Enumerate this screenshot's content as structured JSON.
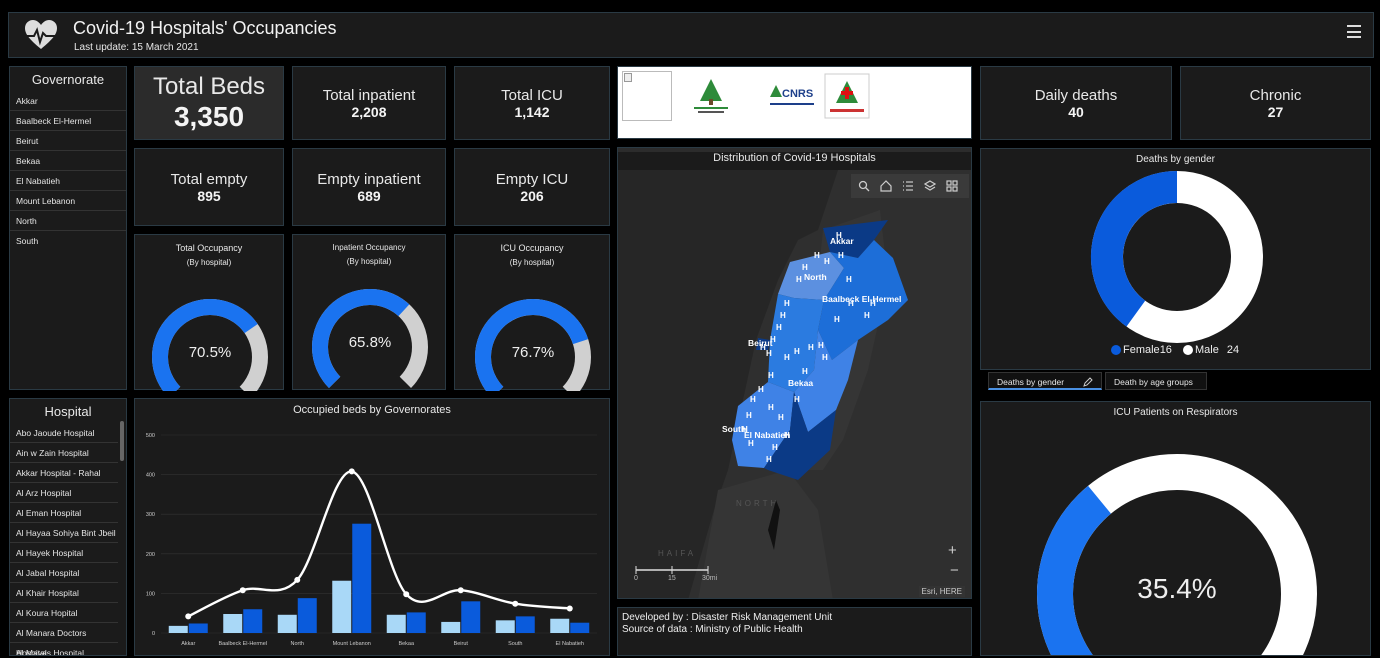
{
  "header": {
    "title": "Covid-19 Hospitals' Occupancies",
    "subtitle": "Last update: 15 March 2021"
  },
  "governorate": {
    "title": "Governorate",
    "items": [
      "Akkar",
      "Baalbeck El-Hermel",
      "Beirut",
      "Bekaa",
      "El Nabatieh",
      "Mount Lebanon",
      "North",
      "South"
    ]
  },
  "kpis": {
    "total_beds": {
      "label": "Total Beds",
      "value": "3,350"
    },
    "total_inpatient": {
      "label": "Total inpatient",
      "value": "2,208"
    },
    "total_icu": {
      "label": "Total ICU",
      "value": "1,142"
    },
    "total_empty": {
      "label": "Total empty",
      "value": "895"
    },
    "empty_inpatient": {
      "label": "Empty inpatient",
      "value": "689"
    },
    "empty_icu": {
      "label": "Empty ICU",
      "value": "206"
    },
    "daily_deaths": {
      "label": "Daily deaths",
      "value": "40"
    },
    "chronic": {
      "label": "Chronic",
      "value": "27"
    }
  },
  "gauges": {
    "total": {
      "title": "Total Occupancy",
      "sub": "(By hospital)",
      "value": "70.5%",
      "fraction": 0.705
    },
    "inpatient": {
      "title": "Inpatient Occupancy",
      "sub": "(By hospital)",
      "value": "65.8%",
      "fraction": 0.658
    },
    "icu": {
      "title": "ICU Occupancy",
      "sub": "(By hospital)",
      "value": "76.7%",
      "fraction": 0.767
    },
    "respirators": {
      "title": "ICU Patients on Respirators",
      "value": "35.4%",
      "fraction": 0.354
    }
  },
  "hospital": {
    "title": "Hospital",
    "items": [
      "Abo Jaoude Hospital",
      "Ain w Zain Hospital",
      "Akkar Hospital - Rahal",
      "Al Arz Hospital",
      "Al Eman Hospital",
      "Al Hayaa Sohiya Bint Jbeil",
      "Al Hayek Hospital",
      "Al Jabal Hospital",
      "Al Khair Hospital",
      "Al Koura Hopital",
      "Al Manara Doctors Hospital",
      "Al Mayas Hospital"
    ]
  },
  "map": {
    "title": "Distribution of Covid-19 Hospitals",
    "labels": [
      "Akkar",
      "North",
      "Baalbeck El-Hermel",
      "Beirut",
      "Bekaa",
      "South",
      "El Nabatieh"
    ],
    "attribution": "Esri, HERE",
    "scale": [
      "0",
      "15",
      "30mi"
    ],
    "bg_labels": [
      "NORTH",
      "HAIFA"
    ],
    "zoom_in": "+",
    "zoom_out": "−"
  },
  "credits": {
    "line1": "Developed by :  Disaster Risk Management Unit",
    "line2": "Source of data :  Ministry of Public Health"
  },
  "gender": {
    "title": "Deaths by gender",
    "female_label": "Female",
    "female_value": "16",
    "male_label": "Male",
    "male_value": "24",
    "female_color": "#0a5bdc",
    "male_color": "#ffffff"
  },
  "tabs": {
    "gender": "Deaths by gender",
    "age": "Death by age groups"
  },
  "chart_data": {
    "type": "bar",
    "title": "Occupied beds by Governorates",
    "categories": [
      "Akkar",
      "Baalbeck El-Hermel",
      "North",
      "Mount Lebanon",
      "Bekaa",
      "Beirut",
      "South",
      "El Nabatieh"
    ],
    "series": [
      {
        "values": [
          18,
          48,
          46,
          132,
          46,
          28,
          32,
          36
        ],
        "color": "#a9d8f7"
      },
      {
        "values": [
          24,
          60,
          88,
          276,
          52,
          80,
          42,
          26
        ],
        "color": "#0a5bdc"
      },
      {
        "values": [
          42,
          108,
          134,
          408,
          98,
          108,
          74,
          62
        ],
        "color": "#ffffff",
        "kind": "line"
      }
    ],
    "ylim": [
      0,
      500
    ],
    "yticks": [
      "0",
      "100",
      "200",
      "300",
      "400",
      "500"
    ],
    "grid": true
  }
}
